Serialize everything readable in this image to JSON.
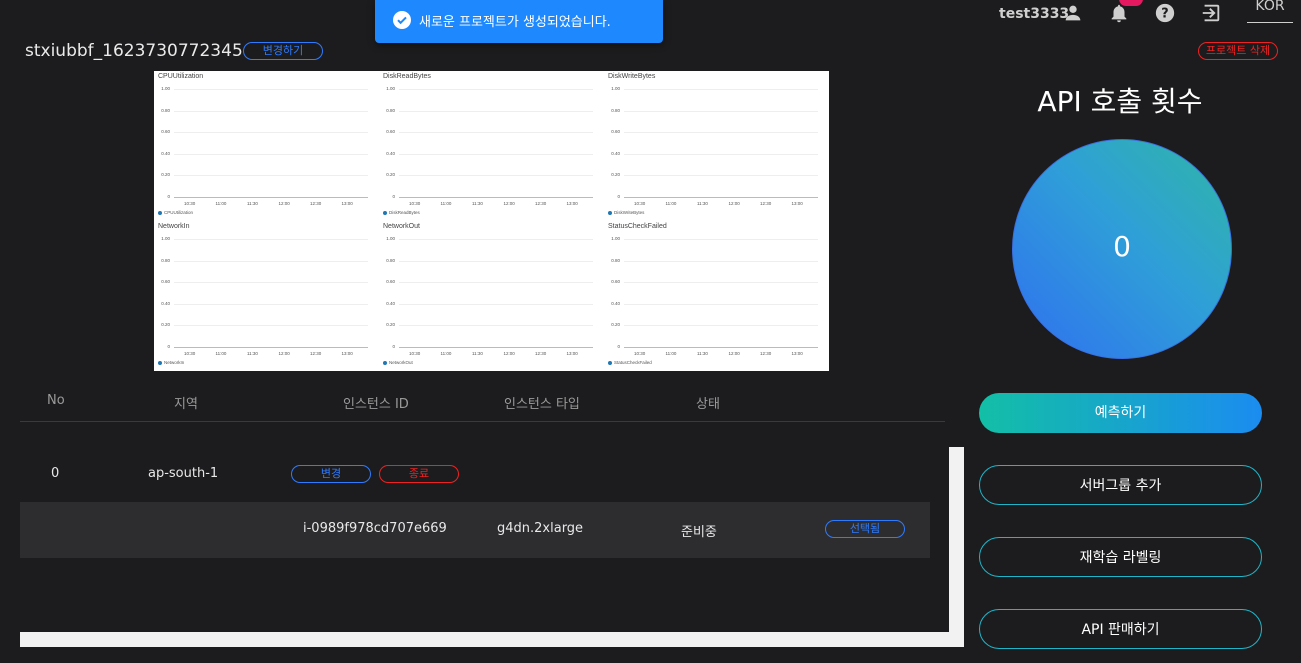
{
  "header": {
    "username": "test3333",
    "icons": [
      "user-icon",
      "bell-icon",
      "help-icon",
      "logout-icon"
    ],
    "language": "KOR"
  },
  "toast": {
    "message": "새로운 프로젝트가 생성되었습니다."
  },
  "project": {
    "name": "stxiubbf_1623730772345",
    "rename_label": "변경하기",
    "delete_label": "프로젝트 삭제"
  },
  "metrics": {
    "charts": [
      {
        "title": "CPUUtilization",
        "legend": "CPUUtilization"
      },
      {
        "title": "DiskReadBytes",
        "legend": "DiskReadBytes"
      },
      {
        "title": "DiskWriteBytes",
        "legend": "DiskWriteBytes"
      },
      {
        "title": "NetworkIn",
        "legend": "NetworkIn"
      },
      {
        "title": "NetworkOut",
        "legend": "NetworkOut"
      },
      {
        "title": "StatusCheckFailed",
        "legend": "StatusCheckFailed"
      }
    ],
    "y_ticks": [
      "1.00",
      "0.80",
      "0.60",
      "0.40",
      "0.20",
      "0"
    ],
    "x_ticks": [
      "10:30",
      "11:00",
      "11:30",
      "12:00",
      "12:30",
      "13:00"
    ],
    "series_color": "#1f77b4"
  },
  "table": {
    "headers": [
      "No",
      "지역",
      "인스턴스 ID",
      "인스턴스 타입",
      "상태"
    ],
    "group": {
      "no": "0",
      "region": "ap-south-1",
      "change_label": "변경",
      "terminate_label": "종료"
    },
    "instance": {
      "id": "i-0989f978cd707e669",
      "type": "g4dn.2xlarge",
      "status": "준비중",
      "selected_label": "선택됨"
    }
  },
  "side": {
    "api_title": "API 호출 횟수",
    "api_count": "0",
    "predict_label": "예측하기",
    "add_server_group_label": "서버그룹 추가",
    "retrain_label": "재학습 라벨링",
    "sell_api_label": "API 판매하기"
  }
}
